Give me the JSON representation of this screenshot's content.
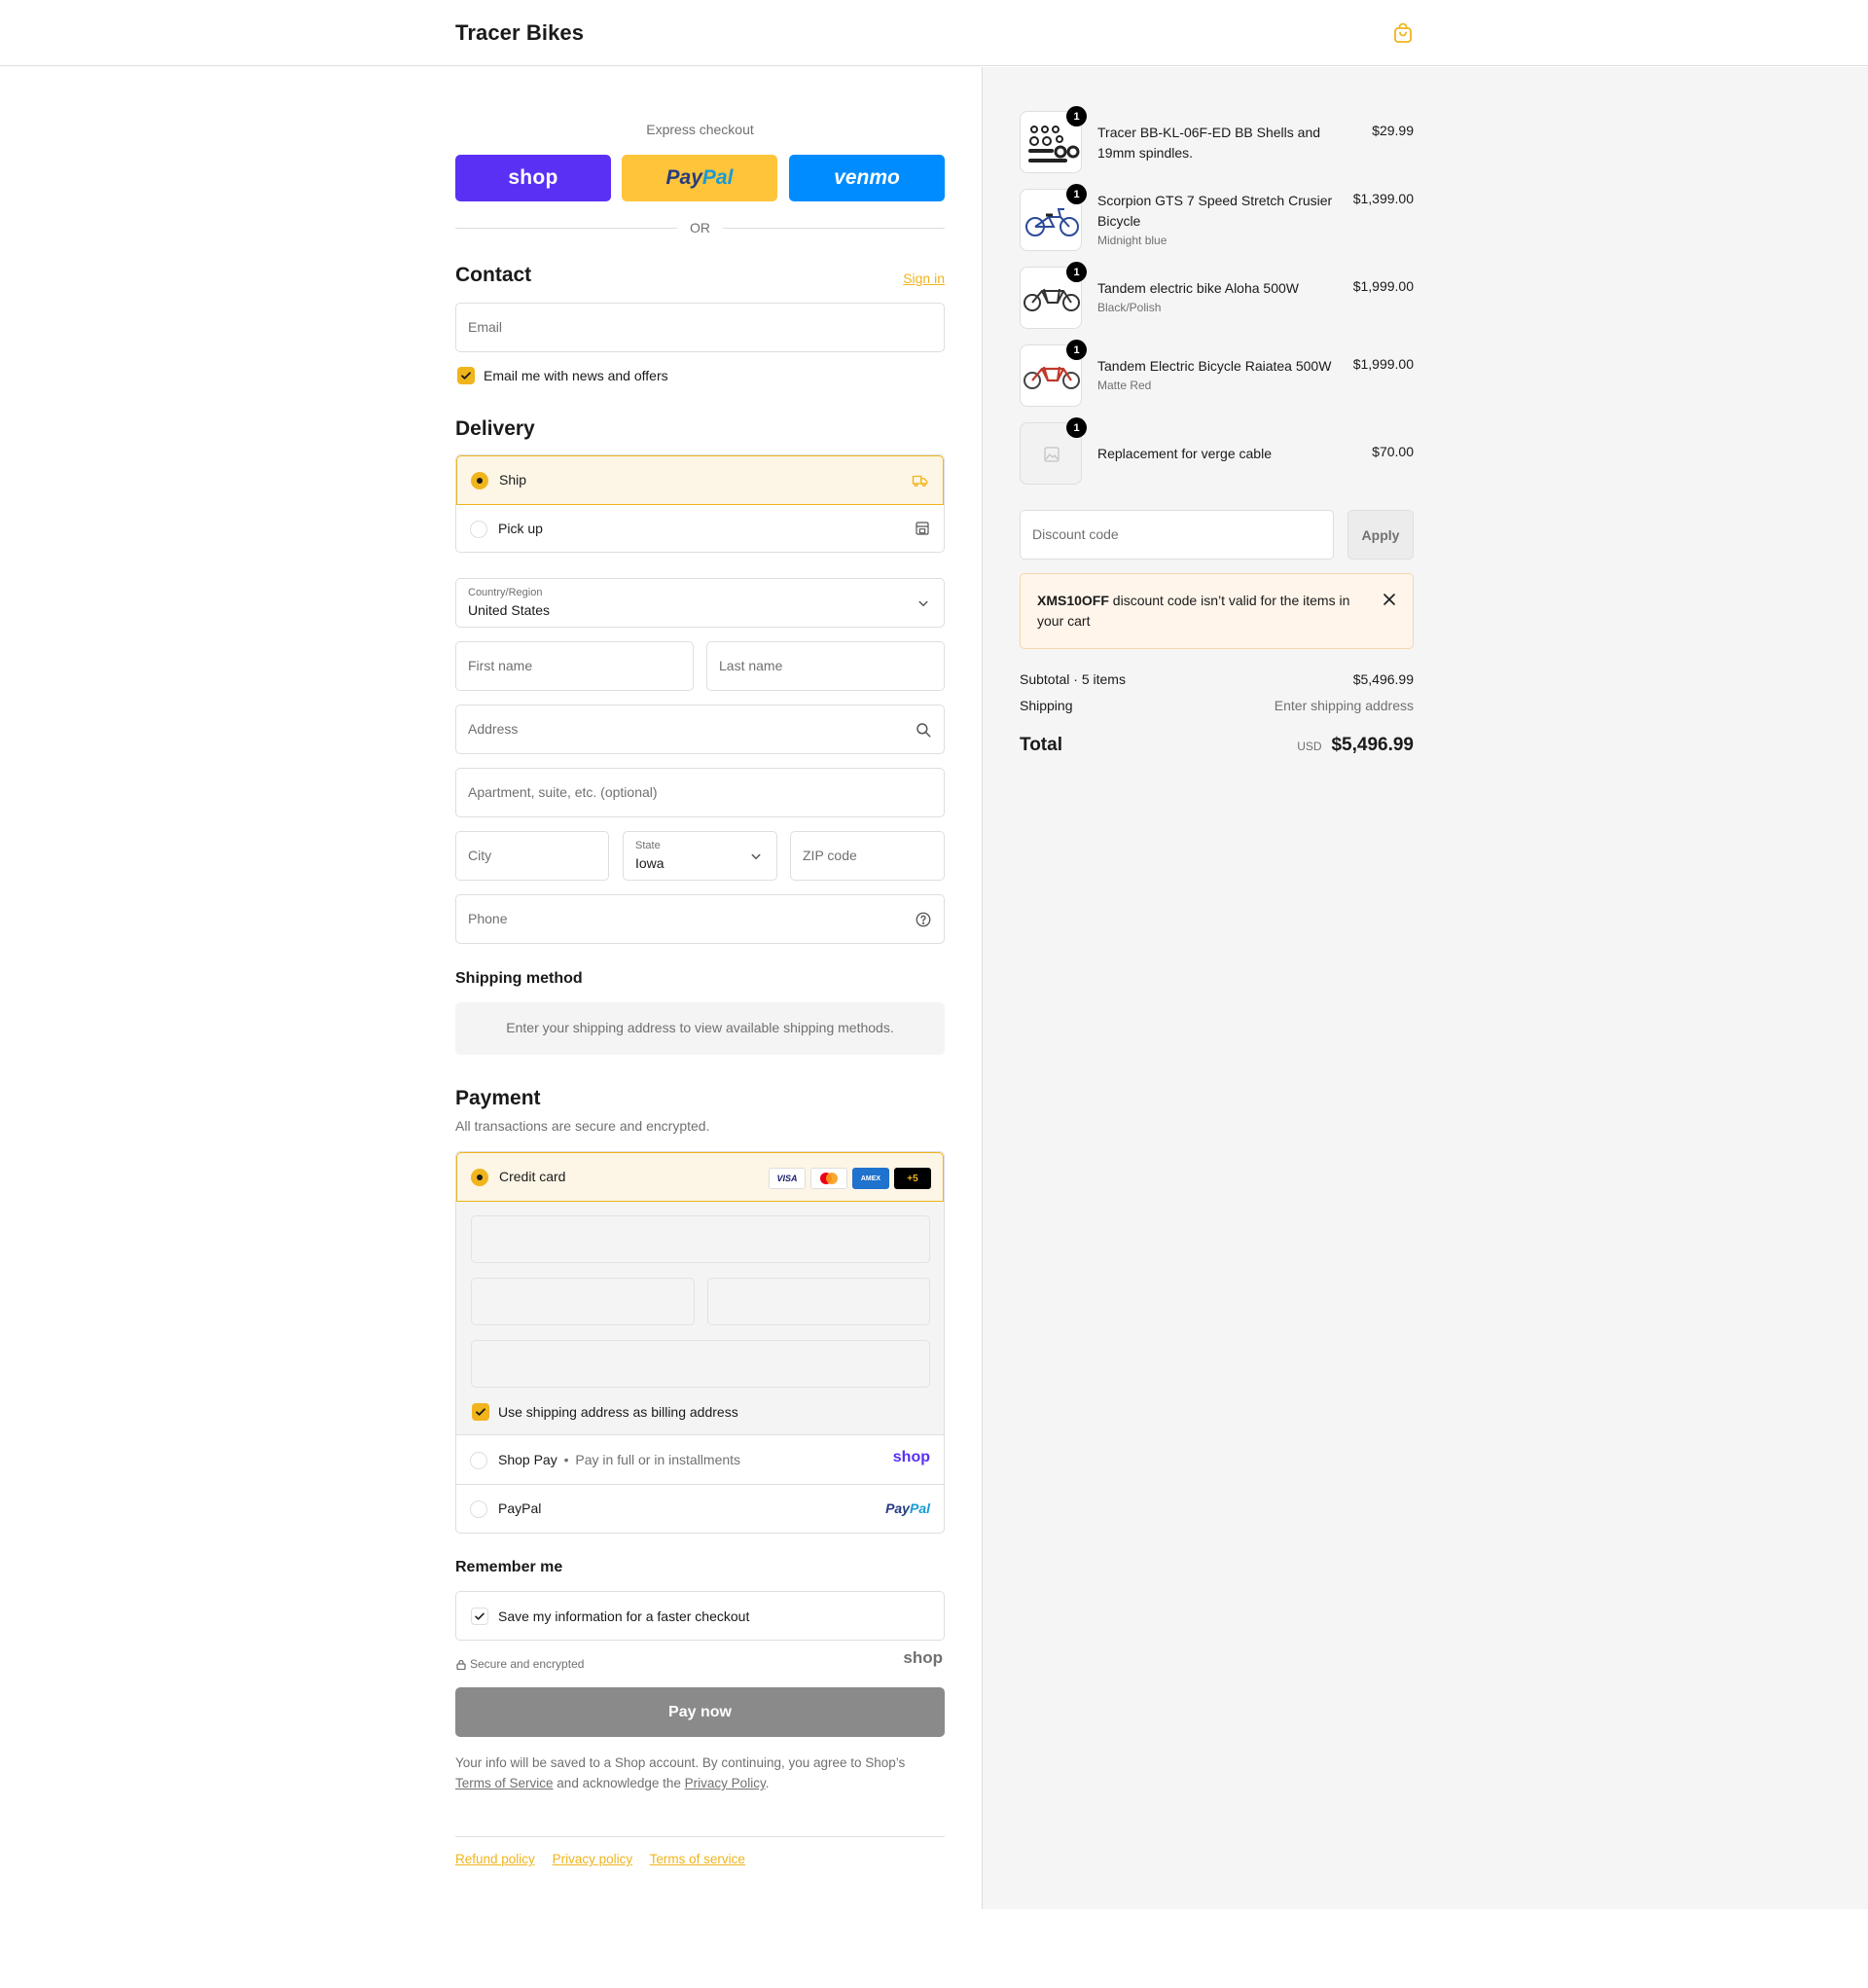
{
  "header": {
    "brand": "Tracer Bikes",
    "cart_icon": "shopping-bag-icon"
  },
  "express": {
    "title": "Express checkout",
    "shop_label": "shop",
    "paypal_label_a": "Pay",
    "paypal_label_b": "Pal",
    "venmo_label": "venmo",
    "or": "OR"
  },
  "contact": {
    "title": "Contact",
    "sign_in": "Sign in",
    "email_placeholder": "Email",
    "news_label": "Email me with news and offers"
  },
  "delivery": {
    "title": "Delivery",
    "ship_label": "Ship",
    "pickup_label": "Pick up",
    "country_label": "Country/Region",
    "country_value": "United States",
    "first_name": "First name",
    "last_name": "Last name",
    "address": "Address",
    "apartment": "Apartment, suite, etc. (optional)",
    "city": "City",
    "state_label": "State",
    "state_value": "Iowa",
    "zip": "ZIP code",
    "phone": "Phone"
  },
  "shipping_method": {
    "title": "Shipping method",
    "message": "Enter your shipping address to view available shipping methods."
  },
  "payment": {
    "title": "Payment",
    "subtitle": "All transactions are secure and encrypted.",
    "credit_card": "Credit card",
    "card_more": "+5",
    "card_visa": "VISA",
    "card_amex": "AMEX",
    "billing_label": "Use shipping address as billing address",
    "shop_pay": "Shop Pay",
    "shop_pay_note": "Pay in full or in installments",
    "shop_logo": "shop",
    "paypal": "PayPal",
    "paypal_logo_a": "Pay",
    "paypal_logo_b": "Pal"
  },
  "remember": {
    "title": "Remember me",
    "save_label": "Save my information for a faster checkout",
    "secure": "Secure and encrypted",
    "shop_logo": "shop"
  },
  "pay_now": "Pay now",
  "legal": {
    "text_1": "Your info will be saved to a Shop account. By continuing, you agree to Shop’s",
    "tos": "Terms of Service",
    "text_2": "and acknowledge the",
    "privacy": "Privacy Policy",
    "text_3": "."
  },
  "footer": {
    "refund": "Refund policy",
    "privacy": "Privacy policy",
    "terms": "Terms of service"
  },
  "cart": {
    "items": [
      {
        "qty": "1",
        "name": "Tracer BB-KL-06F-ED BB Shells and 19mm spindles.",
        "variant": "",
        "price": "$29.99"
      },
      {
        "qty": "1",
        "name": "Scorpion GTS 7 Speed Stretch Crusier Bicycle",
        "variant": "Midnight blue",
        "price": "$1,399.00"
      },
      {
        "qty": "1",
        "name": "Tandem electric bike Aloha 500W",
        "variant": "Black/Polish",
        "price": "$1,999.00"
      },
      {
        "qty": "1",
        "name": "Tandem Electric Bicycle Raiatea 500W",
        "variant": "Matte Red",
        "price": "$1,999.00"
      },
      {
        "qty": "1",
        "name": "Replacement for verge cable",
        "variant": "",
        "price": "$70.00"
      }
    ],
    "discount_placeholder": "Discount code",
    "apply": "Apply",
    "notice_code": "XMS10OFF",
    "notice_text": " discount code isn’t valid for the items in your cart",
    "subtotal_label": "Subtotal · 5 items",
    "subtotal_value": "$5,496.99",
    "shipping_label": "Shipping",
    "shipping_value": "Enter shipping address",
    "total_label": "Total",
    "total_currency": "USD",
    "total_value": "$5,496.99"
  },
  "colors": {
    "accent": "#f0b41c",
    "shop": "#5a31f4",
    "paypal": "#ffc439",
    "venmo": "#008cff"
  }
}
